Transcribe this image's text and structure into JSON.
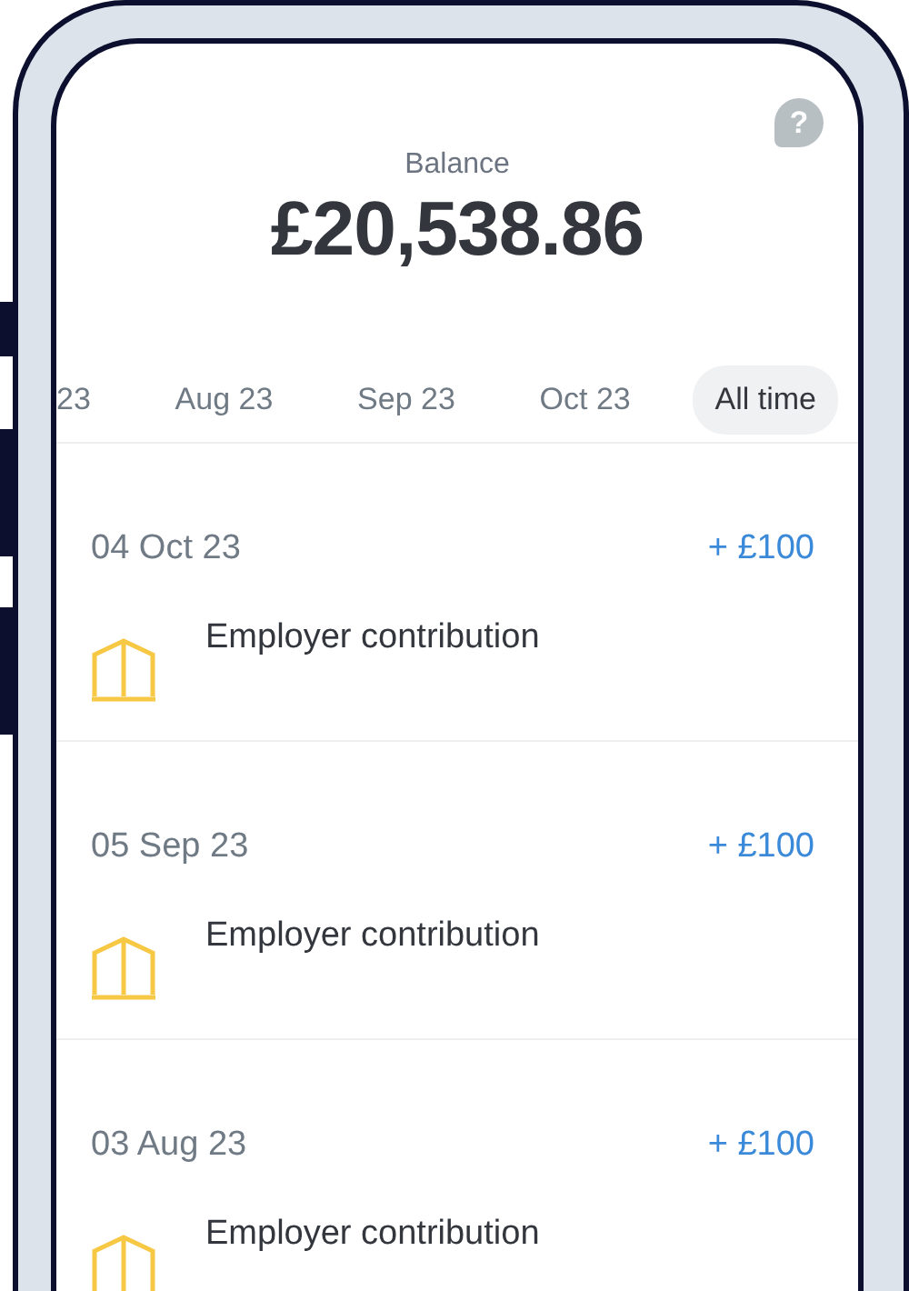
{
  "help_button": "?",
  "balance": {
    "label": "Balance",
    "amount": "£20,538.86"
  },
  "tabs": [
    {
      "label": "23",
      "selected": false
    },
    {
      "label": "Aug 23",
      "selected": false
    },
    {
      "label": "Sep 23",
      "selected": false
    },
    {
      "label": "Oct 23",
      "selected": false
    },
    {
      "label": "All time",
      "selected": true
    }
  ],
  "transactions": [
    {
      "date": "04 Oct 23",
      "amount": "+ £100",
      "description": "Employer contribution"
    },
    {
      "date": "05 Sep 23",
      "amount": "+ £100",
      "description": "Employer contribution"
    },
    {
      "date": "03 Aug 23",
      "amount": "+ £100",
      "description": "Employer contribution"
    }
  ]
}
